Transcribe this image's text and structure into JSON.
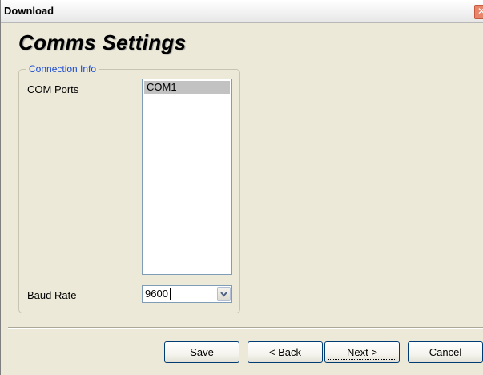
{
  "window": {
    "title": "Download",
    "close_glyph": "✕"
  },
  "page": {
    "heading": "Comms Settings"
  },
  "connection": {
    "group_label": "Connection Info",
    "com_ports_label": "COM Ports",
    "com_ports": [
      "COM1"
    ],
    "selected_com_port": "COM1",
    "baud_rate_label": "Baud Rate",
    "baud_rate_value": "9600"
  },
  "buttons": {
    "save": "Save",
    "back": "< Back",
    "next": "Next >",
    "cancel": "Cancel"
  },
  "icons": {
    "close": "close-icon",
    "dropdown": "chevron-down-icon"
  },
  "colors": {
    "group_label": "#1a4bd3",
    "selection": "#c2c2c2",
    "dialog_bg": "#ece9d8"
  }
}
